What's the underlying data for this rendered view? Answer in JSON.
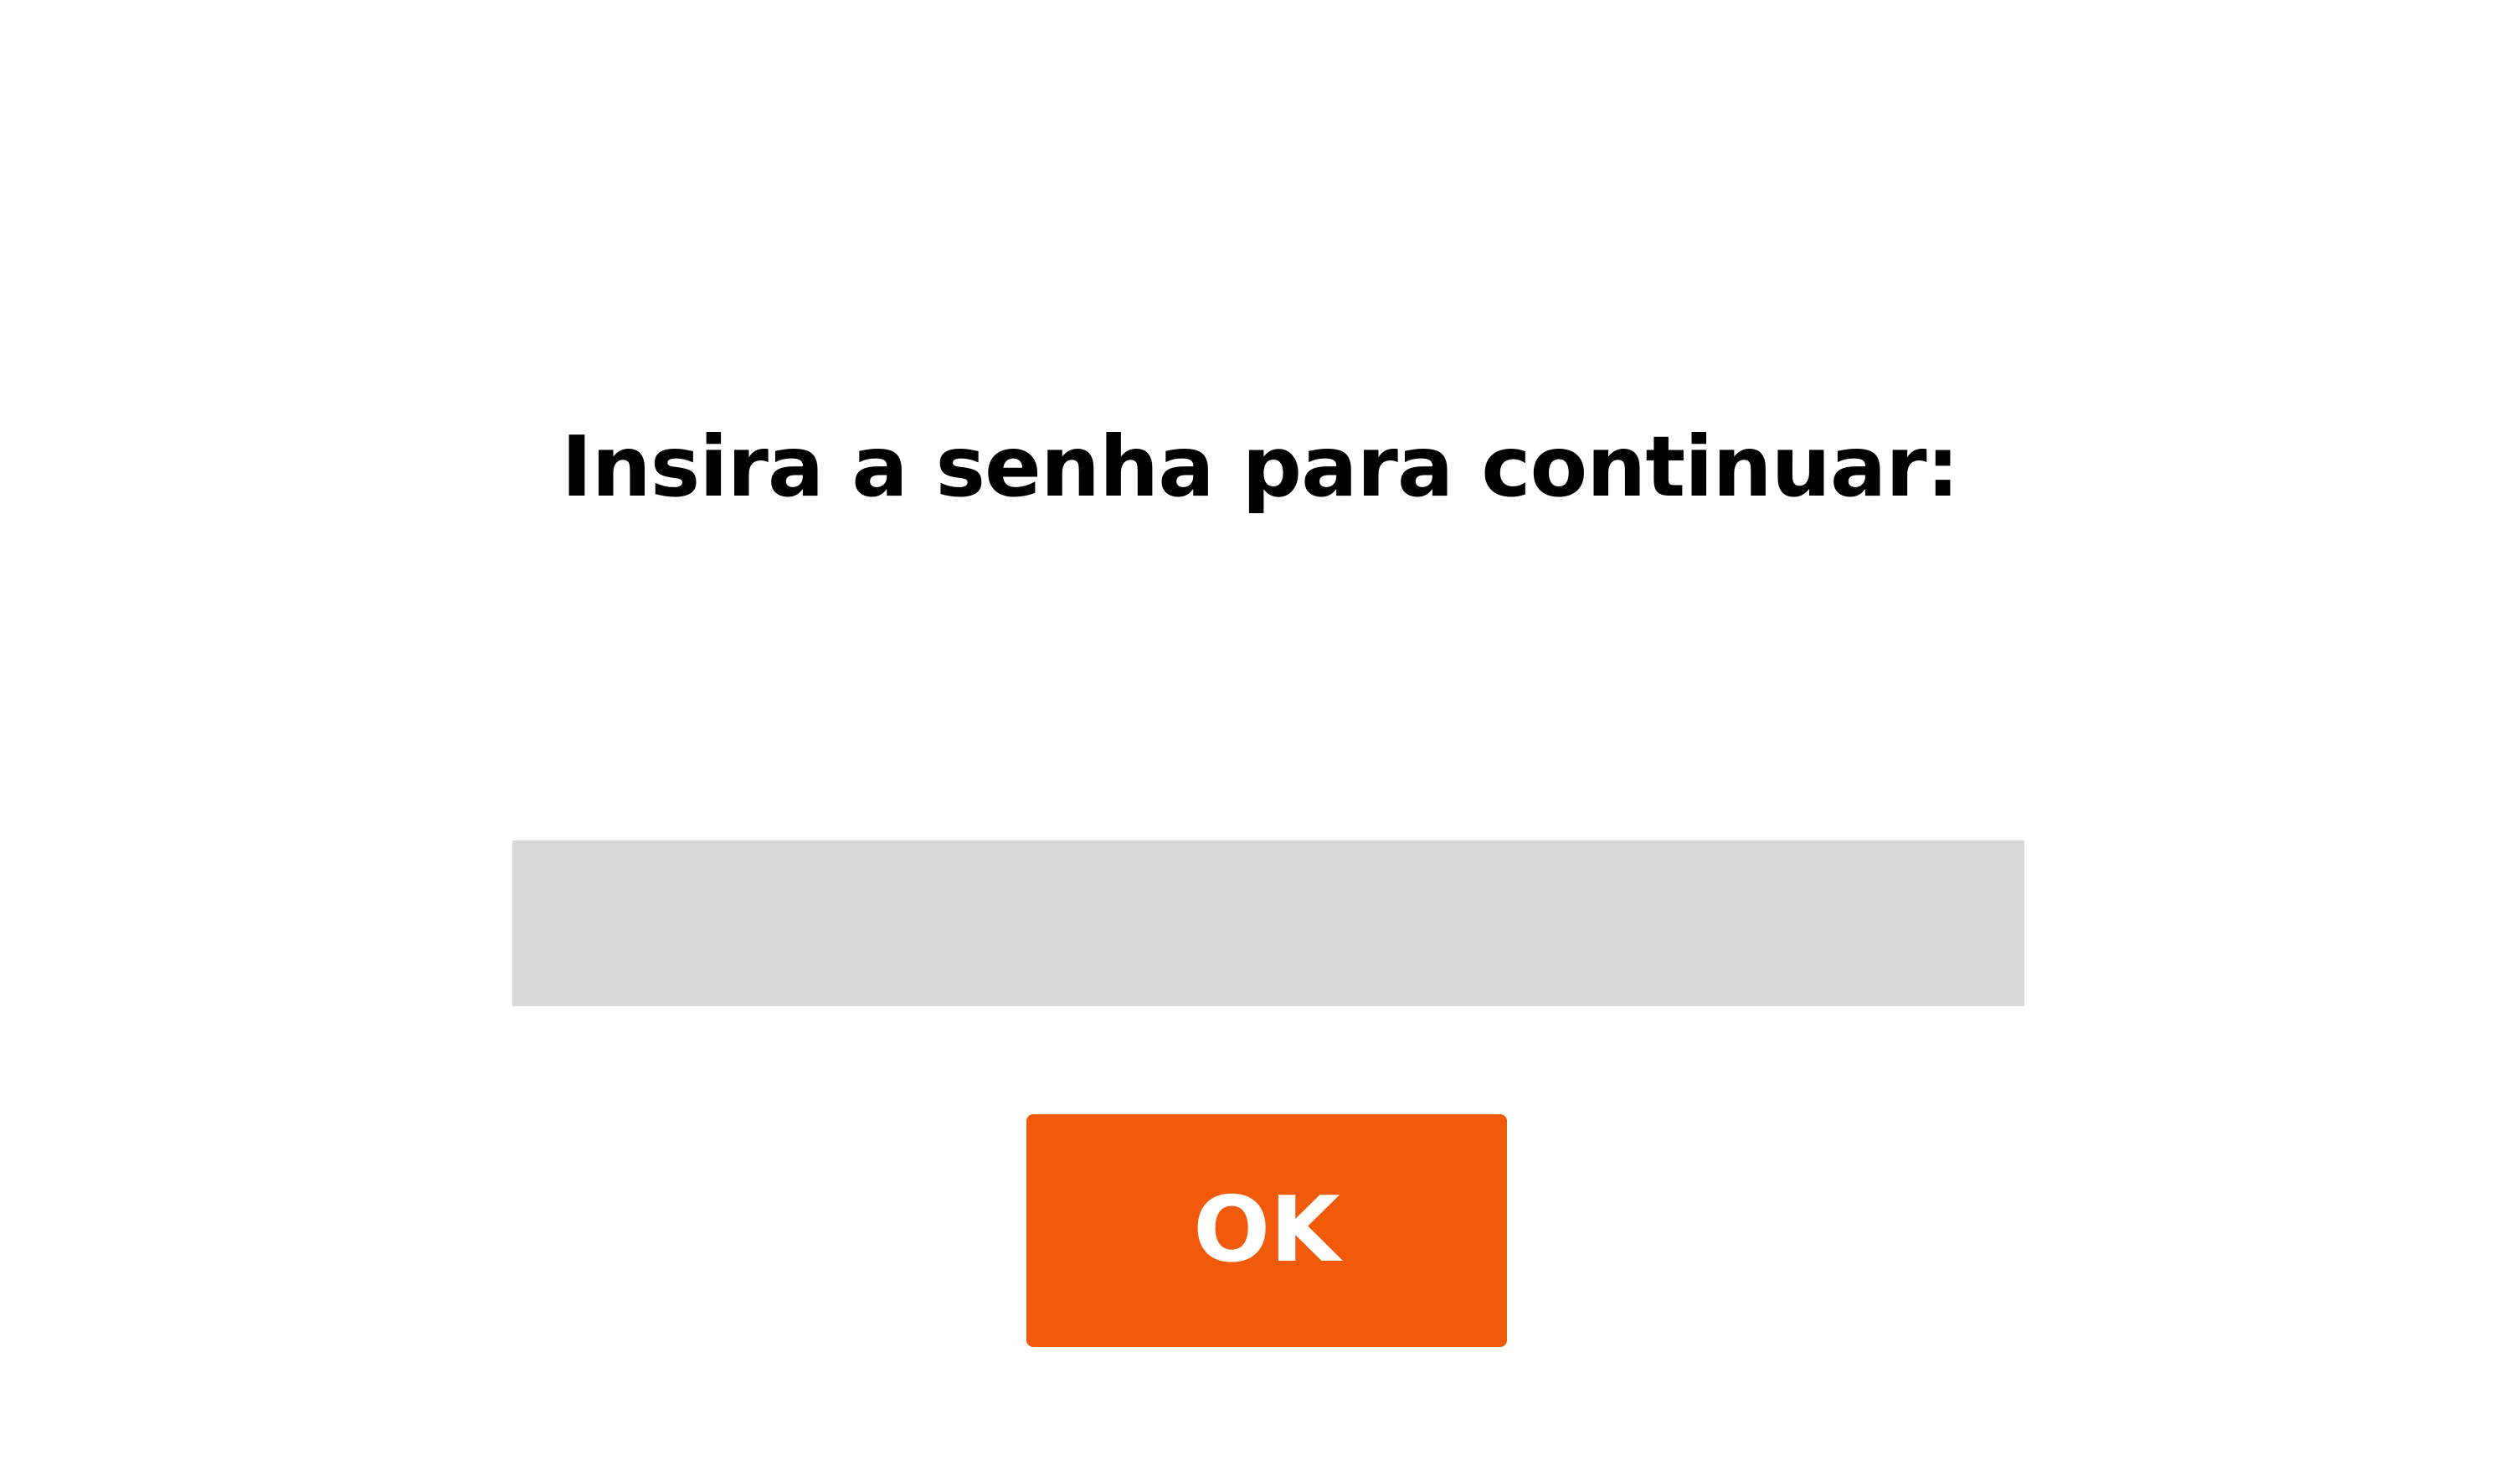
{
  "prompt": {
    "title": "Insira a senha para continuar:"
  },
  "password": {
    "value": "",
    "placeholder": ""
  },
  "ok_button": {
    "label": "OK"
  },
  "colors": {
    "background": "#ffffff",
    "text": "#000000",
    "field_background": "#d9d9d9",
    "button_background": "#f05a0a",
    "button_text": "#ffffff"
  }
}
